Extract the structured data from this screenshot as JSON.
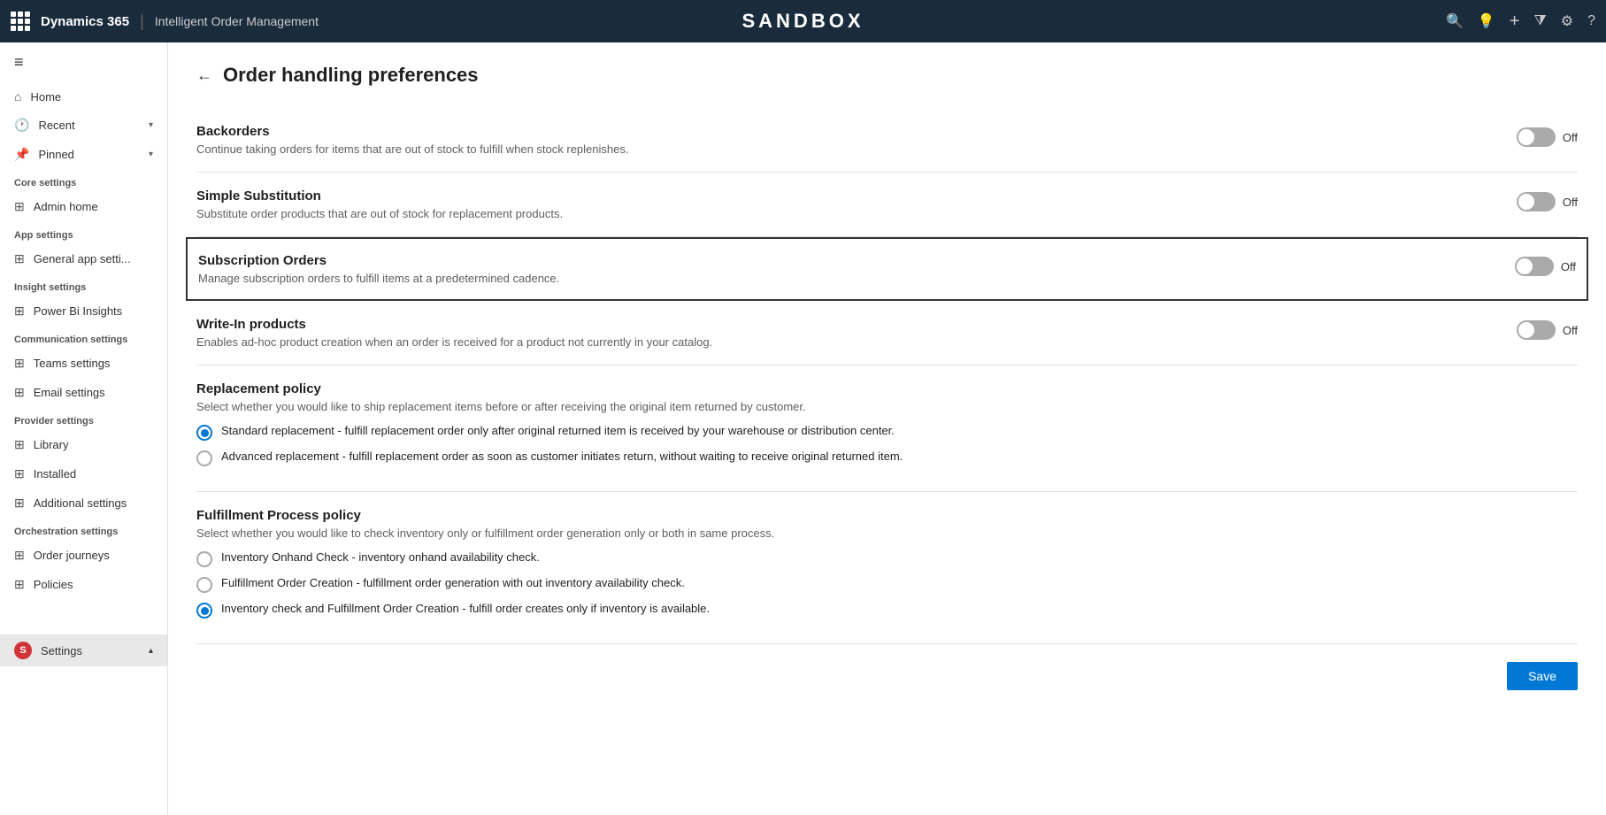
{
  "topnav": {
    "brand": "Dynamics 365",
    "separator": "|",
    "app_name": "Intelligent Order Management",
    "sandbox_label": "SANDBOX",
    "icons": {
      "search": "🔍",
      "lightbulb": "💡",
      "add": "+",
      "funnel": "⧩",
      "settings": "⚙",
      "help": "?"
    }
  },
  "sidebar": {
    "hamburger": "≡",
    "nav_items": [
      {
        "label": "Home",
        "icon": "⌂"
      },
      {
        "label": "Recent",
        "icon": "🕐",
        "chevron": "▾"
      },
      {
        "label": "Pinned",
        "icon": "📌",
        "chevron": "▾"
      }
    ],
    "sections": [
      {
        "label": "Core settings",
        "items": [
          {
            "label": "Admin home",
            "icon": "⊞"
          }
        ]
      },
      {
        "label": "App settings",
        "items": [
          {
            "label": "General app setti...",
            "icon": "⊞"
          }
        ]
      },
      {
        "label": "Insight settings",
        "items": [
          {
            "label": "Power Bi Insights",
            "icon": "⊞"
          }
        ]
      },
      {
        "label": "Communication settings",
        "items": [
          {
            "label": "Teams settings",
            "icon": "⊞"
          },
          {
            "label": "Email settings",
            "icon": "⊞"
          }
        ]
      },
      {
        "label": "Provider settings",
        "items": [
          {
            "label": "Library",
            "icon": "⊞"
          },
          {
            "label": "Installed",
            "icon": "⊞"
          },
          {
            "label": "Additional settings",
            "icon": "⊞"
          }
        ]
      },
      {
        "label": "Orchestration settings",
        "items": [
          {
            "label": "Order journeys",
            "icon": "⊞"
          },
          {
            "label": "Policies",
            "icon": "⊞"
          }
        ]
      }
    ],
    "bottom_item": {
      "label": "Settings",
      "badge": "S",
      "chevron": "▴"
    }
  },
  "page": {
    "back_label": "←",
    "title": "Order handling preferences",
    "settings": [
      {
        "id": "backorders",
        "name": "Backorders",
        "desc": "Continue taking orders for items that are out of stock to fulfill when stock replenishes.",
        "toggle": false,
        "toggle_label": "Off",
        "highlighted": false
      },
      {
        "id": "simple-substitution",
        "name": "Simple Substitution",
        "desc": "Substitute order products that are out of stock for replacement products.",
        "toggle": false,
        "toggle_label": "Off",
        "highlighted": false
      },
      {
        "id": "subscription-orders",
        "name": "Subscription Orders",
        "desc": "Manage subscription orders to fulfill items at a predetermined cadence.",
        "toggle": false,
        "toggle_label": "Off",
        "highlighted": true
      },
      {
        "id": "write-in-products",
        "name": "Write-In products",
        "desc": "Enables ad-hoc product creation when an order is received for a product not currently in your catalog.",
        "toggle": false,
        "toggle_label": "Off",
        "highlighted": false
      }
    ],
    "replacement_policy": {
      "title": "Replacement policy",
      "desc": "Select whether you would like to ship replacement items before or after receiving the original item returned by customer.",
      "options": [
        {
          "id": "standard",
          "label": "Standard replacement - fulfill replacement order only after original returned item is received by your warehouse or distribution center.",
          "selected": true
        },
        {
          "id": "advanced",
          "label": "Advanced replacement - fulfill replacement order as soon as customer initiates return, without waiting to receive original returned item.",
          "selected": false
        }
      ]
    },
    "fulfillment_policy": {
      "title": "Fulfillment Process policy",
      "desc": "Select whether you would like to check inventory only or fulfillment order generation only or both in same process.",
      "options": [
        {
          "id": "inventory-onhand",
          "label": "Inventory Onhand Check - inventory onhand availability check.",
          "selected": false
        },
        {
          "id": "fulfillment-order-creation",
          "label": "Fulfillment Order Creation - fulfillment order generation with out inventory availability check.",
          "selected": false
        },
        {
          "id": "inventory-and-fulfillment",
          "label": "Inventory check and Fulfillment Order Creation - fulfill order creates only if inventory is available.",
          "selected": true
        }
      ]
    },
    "save_button_label": "Save"
  }
}
